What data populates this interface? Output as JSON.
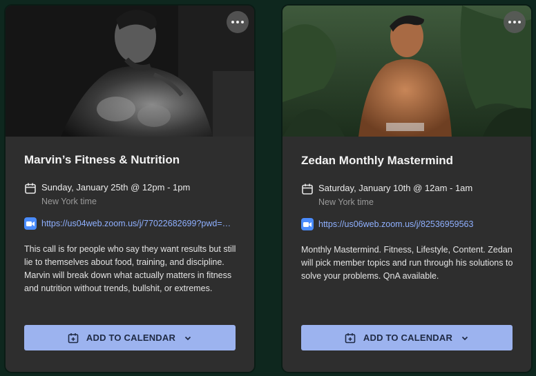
{
  "cards": [
    {
      "title": "Marvin’s Fitness & Nutrition",
      "date": "Sunday, January 25th @ 12pm - 1pm",
      "timezone": "New York time",
      "link": "https://us04web.zoom.us/j/77022682699?pwd=…",
      "description": [
        "This call is for people who say they want results but still lie to themselves about food, training, and discipline.",
        "Marvin will break down what actually matters in fitness and nutrition without trends, bullshit, or extremes."
      ],
      "button_label": "ADD TO CALENDAR"
    },
    {
      "title": "Zedan Monthly Mastermind",
      "date": "Saturday, January 10th @ 12am - 1am",
      "timezone": "New York time",
      "link": "https://us06web.zoom.us/j/82536959563",
      "description": [
        "Monthly Mastermind. Fitness, Lifestyle, Content. Zedan will pick member topics and run through his solutions to solve your problems. QnA available."
      ],
      "button_label": "ADD TO CALENDAR"
    }
  ],
  "colors": {
    "card_bg": "#2e2e2e",
    "button_bg": "#9cb3ef",
    "link": "#8fb0ff",
    "zoom_icon": "#4a8cff"
  },
  "icons": {
    "more": "more-horizontal-icon",
    "calendar": "calendar-icon",
    "video": "zoom-video-icon",
    "add_calendar": "calendar-plus-icon",
    "chevron": "chevron-down-icon"
  }
}
